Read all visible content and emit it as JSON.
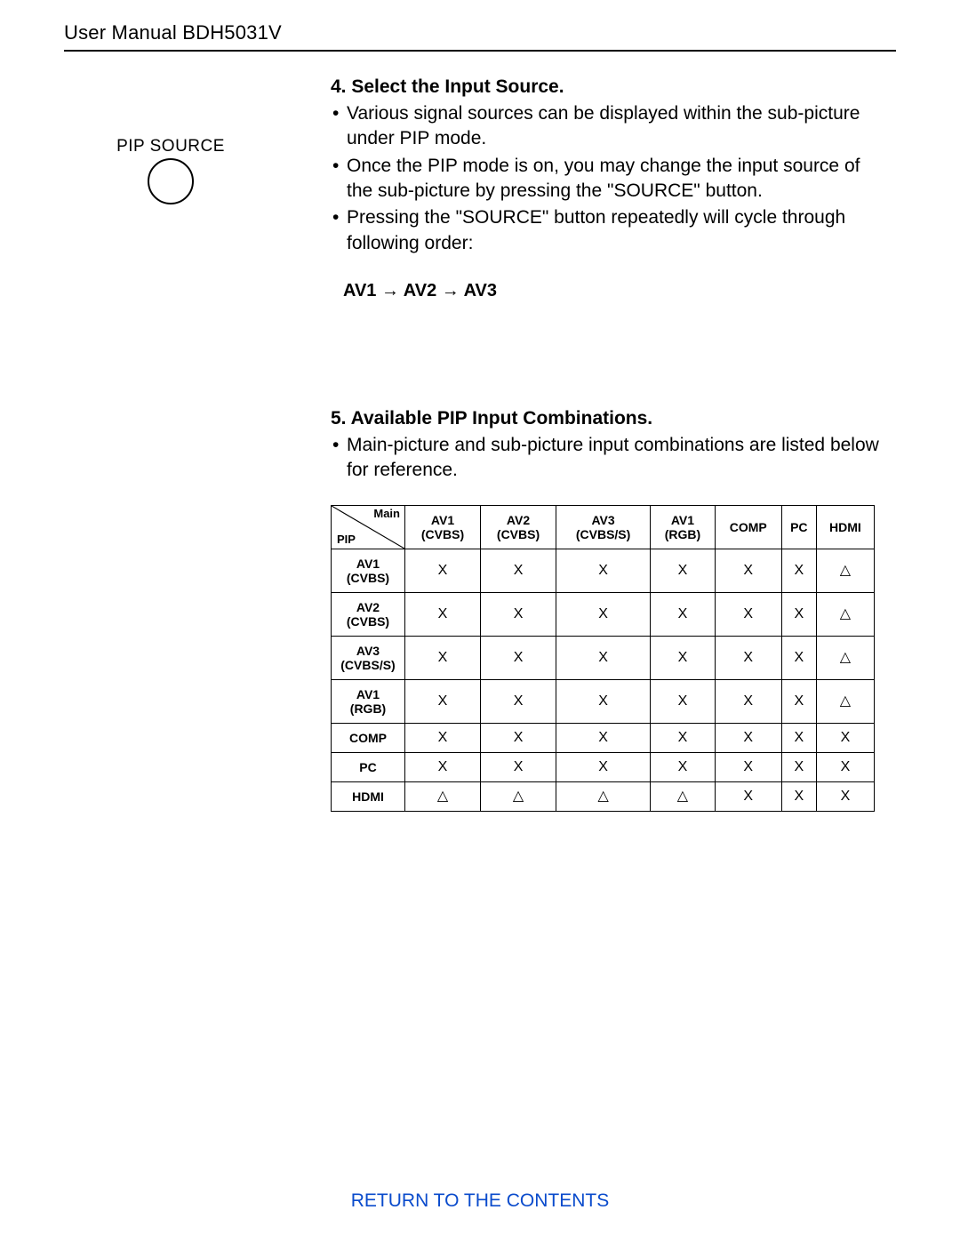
{
  "header": {
    "title": "User Manual BDH5031V"
  },
  "left": {
    "pip_source_label": "PIP SOURCE"
  },
  "section4": {
    "heading": "4. Select the Input Source.",
    "bullets": [
      "Various signal sources can be displayed within the sub-picture under PIP mode.",
      "Once the PIP mode is on, you may change the input source of the sub-picture by pressing the \"SOURCE\" button.",
      "Pressing the \"SOURCE\" button repeatedly will cycle through following order:"
    ],
    "order_formula": "AV1 → AV2 → AV3"
  },
  "section5": {
    "heading": "5. Available PIP Input Combinations.",
    "intro": "Main-picture and sub-picture input combinations are listed below for reference."
  },
  "pip_table": {
    "diag_top": "Main",
    "diag_bottom": "PIP",
    "columns": [
      {
        "l1": "AV1",
        "l2": "(CVBS)"
      },
      {
        "l1": "AV2",
        "l2": "(CVBS)"
      },
      {
        "l1": "AV3",
        "l2": "(CVBS/S)"
      },
      {
        "l1": "AV1",
        "l2": "(RGB)"
      },
      {
        "l1": "COMP",
        "l2": ""
      },
      {
        "l1": "PC",
        "l2": ""
      },
      {
        "l1": "HDMI",
        "l2": ""
      }
    ],
    "rows": [
      {
        "head_l1": "AV1",
        "head_l2": "(CVBS)",
        "cells": [
          "X",
          "X",
          "X",
          "X",
          "X",
          "X",
          "△"
        ]
      },
      {
        "head_l1": "AV2",
        "head_l2": "(CVBS)",
        "cells": [
          "X",
          "X",
          "X",
          "X",
          "X",
          "X",
          "△"
        ]
      },
      {
        "head_l1": "AV3",
        "head_l2": "(CVBS/S)",
        "cells": [
          "X",
          "X",
          "X",
          "X",
          "X",
          "X",
          "△"
        ]
      },
      {
        "head_l1": "AV1",
        "head_l2": "(RGB)",
        "cells": [
          "X",
          "X",
          "X",
          "X",
          "X",
          "X",
          "△"
        ]
      },
      {
        "head_l1": "COMP",
        "head_l2": "",
        "cells": [
          "X",
          "X",
          "X",
          "X",
          "X",
          "X",
          "X"
        ]
      },
      {
        "head_l1": "PC",
        "head_l2": "",
        "cells": [
          "X",
          "X",
          "X",
          "X",
          "X",
          "X",
          "X"
        ]
      },
      {
        "head_l1": "HDMI",
        "head_l2": "",
        "cells": [
          "△",
          "△",
          "△",
          "△",
          "X",
          "X",
          "X"
        ]
      }
    ]
  },
  "footer": {
    "return_link": "RETURN TO THE CONTENTS"
  }
}
